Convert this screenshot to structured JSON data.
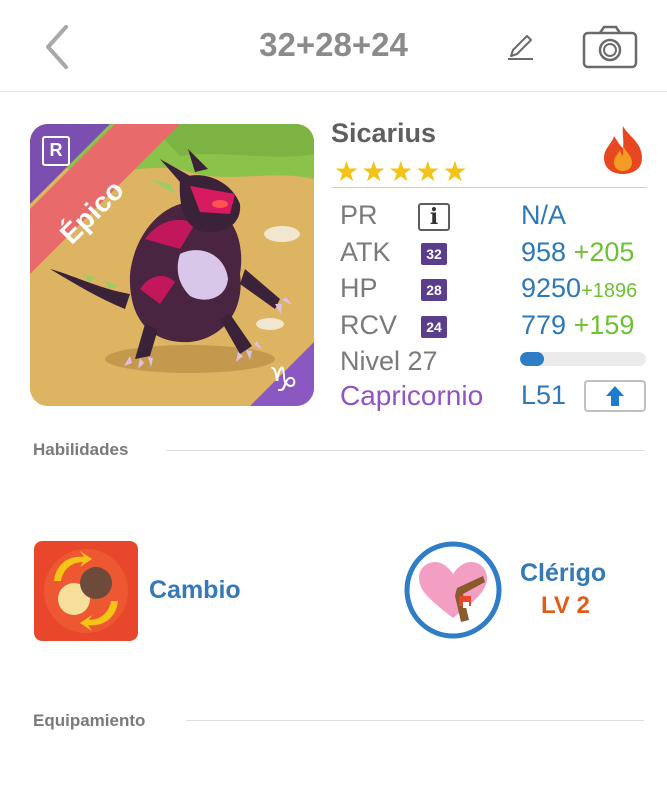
{
  "header": {
    "title": "32+28+24"
  },
  "card": {
    "rarity_badge": "R",
    "rarity": "Épico",
    "zodiac_symbol": "♑"
  },
  "hero": {
    "name": "Sicarius",
    "stars": 5,
    "stars_text": "★★★★★",
    "element_icon": "fire-icon"
  },
  "stats": {
    "pr": {
      "label": "PR",
      "value": "N/A"
    },
    "atk": {
      "label": "ATK",
      "badge": "32",
      "value": "958",
      "bonus": "+205"
    },
    "hp": {
      "label": "HP",
      "badge": "28",
      "value": "9250",
      "bonus": "+1896"
    },
    "rcv": {
      "label": "RCV",
      "badge": "24",
      "value": "779",
      "bonus": "+159"
    },
    "level": {
      "label": "Nivel 27",
      "progress": 0.19
    },
    "zodiac": "Capricornio",
    "leader_level": "L51"
  },
  "sections": {
    "skills": "Habilidades",
    "equipment": "Equipamiento"
  },
  "skill": {
    "label": "Cambio"
  },
  "class": {
    "label": "Clérigo",
    "level": "LV 2"
  },
  "colors": {
    "accent_blue": "#2e78b8",
    "bonus_green": "#6fc033",
    "zodiac_purple": "#9352c3",
    "class_level_orange": "#e05d17",
    "star_gold": "#f3c317"
  }
}
